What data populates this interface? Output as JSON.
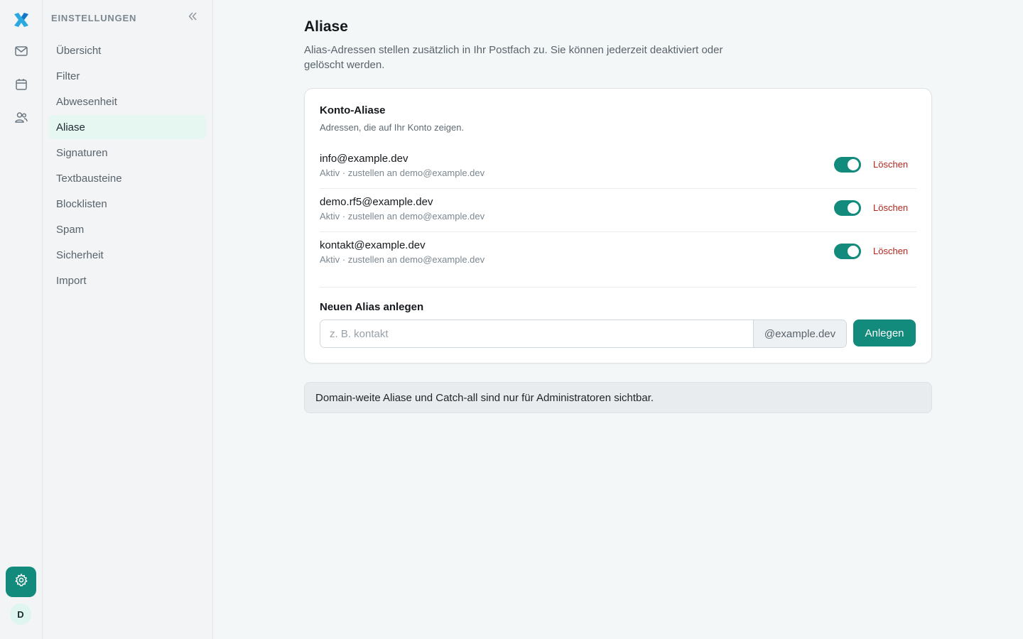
{
  "rail": {
    "avatar_initial": "D",
    "icons": [
      "logo-icon",
      "mail-icon",
      "calendar-icon",
      "contacts-icon",
      "settings-icon"
    ],
    "accent": "#128a7c"
  },
  "sidebar": {
    "title": "EINSTELLUNGEN",
    "items": [
      {
        "label": "Übersicht",
        "active": false
      },
      {
        "label": "Filter",
        "active": false
      },
      {
        "label": "Abwesenheit",
        "active": false
      },
      {
        "label": "Aliase",
        "active": true
      },
      {
        "label": "Signaturen",
        "active": false
      },
      {
        "label": "Textbausteine",
        "active": false
      },
      {
        "label": "Blocklisten",
        "active": false
      },
      {
        "label": "Spam",
        "active": false
      },
      {
        "label": "Sicherheit",
        "active": false
      },
      {
        "label": "Import",
        "active": false
      }
    ]
  },
  "main": {
    "title": "Aliase",
    "description": "Alias-Adressen stellen zusätzlich in Ihr Postfach zu. Sie können jederzeit deaktiviert oder gelöscht werden.",
    "card": {
      "title": "Konto-Aliase",
      "subtitle": "Adressen, die auf Ihr Konto zeigen.",
      "aliases": [
        {
          "address": "info@example.dev",
          "meta": "Aktiv · zustellen an demo@example.dev",
          "enabled": true,
          "delete_label": "Löschen"
        },
        {
          "address": "demo.rf5@example.dev",
          "meta": "Aktiv · zustellen an demo@example.dev",
          "enabled": true,
          "delete_label": "Löschen"
        },
        {
          "address": "kontakt@example.dev",
          "meta": "Aktiv · zustellen an demo@example.dev",
          "enabled": true,
          "delete_label": "Löschen"
        }
      ],
      "new_alias": {
        "title": "Neuen Alias anlegen",
        "value": "",
        "placeholder": "z. B. kontakt",
        "suffix": "@example.dev",
        "button_label": "Anlegen"
      }
    },
    "notice": "Domain-weite Aliase und Catch-all sind nur für Administratoren sichtbar."
  }
}
